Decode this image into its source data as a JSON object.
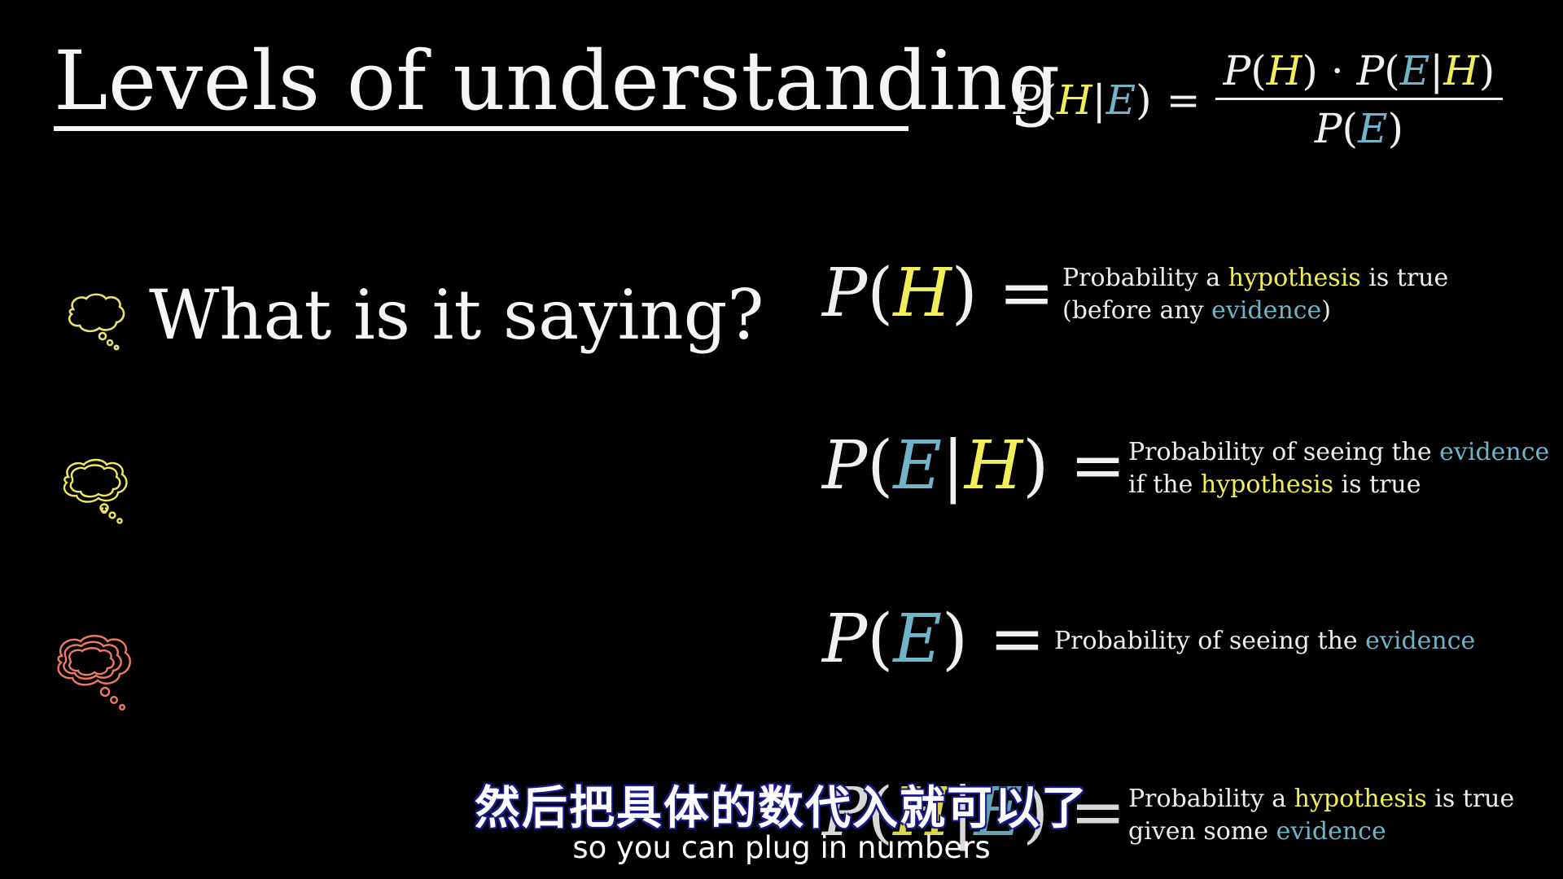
{
  "title": "Levels of understanding",
  "question": "What is it saying?",
  "bayes": {
    "P": "P",
    "H": "H",
    "E": "E",
    "bar": "|",
    "eq": "=",
    "dot": "·",
    "lp": "(",
    "rp": ")"
  },
  "definitions": [
    {
      "text_line1": [
        "Probability a ",
        "hypothesis",
        " is true"
      ],
      "text_line2": [
        "(before any ",
        "evidence",
        ")"
      ]
    },
    {
      "text_line1": [
        "Probability of seeing the ",
        "evidence"
      ],
      "text_line2": [
        "if the ",
        "hypothesis",
        " is true"
      ]
    },
    {
      "text_line1": [
        "Probability of seeing the ",
        "evidence"
      ]
    },
    {
      "text_line1": [
        "Probability a ",
        "hypothesis",
        " is true"
      ],
      "text_line2": [
        "given some ",
        "evidence"
      ]
    }
  ],
  "subtitles": {
    "chinese": "然后把具体的数代入就可以了",
    "english": "so you can plug in numbers"
  },
  "colors": {
    "hypothesis": "#f2ee5a",
    "evidence": "#6fb4c9",
    "bubble_1": "#e8e070",
    "bubble_2": "#f0e860",
    "bubble_3": "#ee7a62"
  },
  "icons": [
    "thought-bubble-icon",
    "thought-bubble-icon",
    "thought-bubble-icon"
  ]
}
